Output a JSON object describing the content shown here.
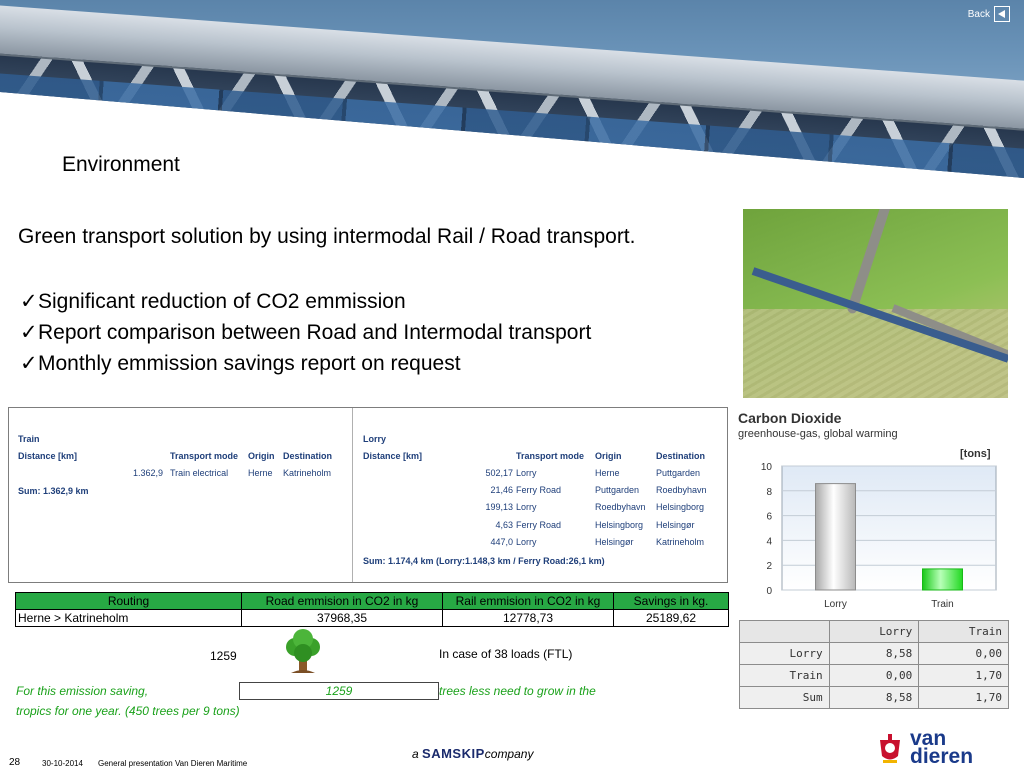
{
  "nav": {
    "back_label": "Back",
    "back_icon": "back-arrow-icon"
  },
  "section_title": "Environment",
  "headline": "Green transport solution by using intermodal Rail / Road  transport.",
  "bullets": [
    "Significant reduction of CO2 emmission",
    "Report comparison between Road and Intermodal transport",
    "Monthly emmission savings report on request"
  ],
  "route_panel": {
    "train": {
      "title": "Train",
      "headers": [
        "Distance [km]",
        "Transport mode",
        "Origin",
        "Destination"
      ],
      "rows": [
        {
          "distance": "1.362,9",
          "mode": "Train electrical",
          "origin": "Herne",
          "destination": "Katrineholm"
        }
      ],
      "sum": "Sum: 1.362,9 km"
    },
    "lorry": {
      "title": "Lorry",
      "headers": [
        "Distance [km]",
        "Transport mode",
        "Origin",
        "Destination"
      ],
      "rows": [
        {
          "distance": "502,17",
          "mode": "Lorry",
          "origin": "Herne",
          "destination": "Puttgarden"
        },
        {
          "distance": "21,46",
          "mode": "Ferry Road",
          "origin": "Puttgarden",
          "destination": "Roedbyhavn"
        },
        {
          "distance": "199,13",
          "mode": "Lorry",
          "origin": "Roedbyhavn",
          "destination": "Helsingborg"
        },
        {
          "distance": "4,63",
          "mode": "Ferry Road",
          "origin": "Helsingborg",
          "destination": "Helsingør"
        },
        {
          "distance": "447,0",
          "mode": "Lorry",
          "origin": "Helsingør",
          "destination": "Katrineholm"
        }
      ],
      "sum": "Sum: 1.174,4 km (Lorry:1.148,3 km / Ferry Road:26,1 km)"
    }
  },
  "co2": {
    "title": "Carbon Dioxide",
    "subtitle": "greenhouse-gas, global warming",
    "unit": "[tons]",
    "table": {
      "header": [
        "",
        "Lorry",
        "Train"
      ],
      "rows": [
        [
          "Lorry",
          "8,58",
          "0,00"
        ],
        [
          "Train",
          "0,00",
          "1,70"
        ],
        [
          "Sum",
          "8,58",
          "1,70"
        ]
      ]
    }
  },
  "chart_data": {
    "type": "bar",
    "title": "Carbon Dioxide",
    "subtitle": "greenhouse-gas, global warming",
    "ylabel": "[tons]",
    "categories": [
      "Lorry",
      "Train"
    ],
    "values": [
      8.58,
      1.7
    ],
    "ylim": [
      0,
      10
    ],
    "yticks": [
      0,
      2,
      4,
      6,
      8,
      10
    ],
    "colors": [
      "#c8c8c8",
      "#2ee62e"
    ],
    "grid": true
  },
  "routing_table": {
    "headers": [
      "Routing",
      "Road emmision in CO2 in kg",
      "Rail emmision in CO2  in kg",
      "Savings in kg."
    ],
    "rows": [
      [
        "Herne > Katrineholm",
        "37968,35",
        "12778,73",
        "25189,62"
      ]
    ]
  },
  "tree_count": "1259",
  "loads_note": "In case of 38 loads  (FTL)",
  "saving_text": {
    "part1": "For this emission saving,",
    "value": "1259",
    "part2": "trees less need to grow in the",
    "part3": "tropics for one year. (450 trees per 9 tons)"
  },
  "footer": {
    "page_number": "28",
    "date": "30-10-2014",
    "presentation": "General presentation Van Dieren Maritime",
    "company_prefix": "a",
    "company_brand": "SAMSKIP",
    "company_suffix": "company",
    "logo_line1": "van",
    "logo_line2": "dieren"
  },
  "colors": {
    "table_header_green": "#27a844",
    "saving_text_green": "#1aa11a",
    "chart_blue_text": "#1f3f7a"
  }
}
